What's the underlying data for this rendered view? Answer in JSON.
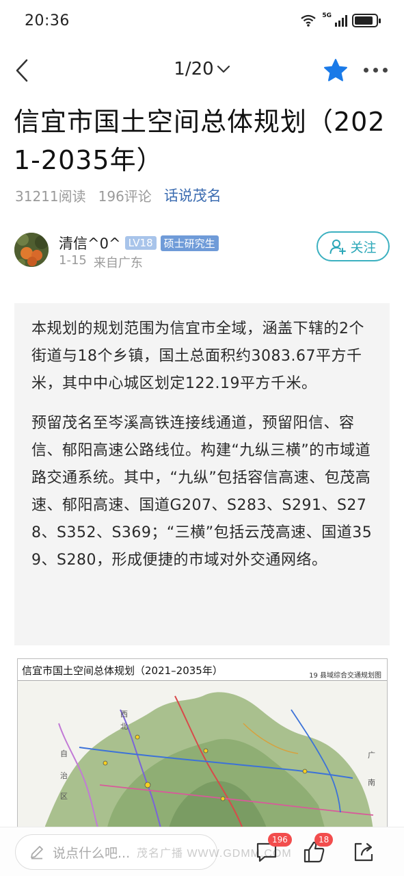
{
  "status_bar": {
    "time": "20:36",
    "network": "5G"
  },
  "nav": {
    "page_indicator": "1/20",
    "star_color": "#1a7ae8"
  },
  "article": {
    "title": "信宜市国土空间总体规划（2021-2035年）",
    "reads": "31211阅读",
    "comments": "196评论",
    "topic": "话说茂名",
    "author": {
      "name": "清信^0^",
      "level": "LV18",
      "degree": "硕士研究生",
      "date": "1-15",
      "location": "来自广东",
      "follow_label": "关注"
    },
    "paragraphs": [
      "本规划的规划范围为信宜市全域，涵盖下辖的2个街道与18个乡镇，国土总面积约3083.67平方千米，其中中心城区划定122.19平方千米。",
      "预留茂名至岑溪高铁连接线通道，预留阳信、容信、郁阳高速公路线位。构建“九纵三横”的市域道路交通系统。其中，“九纵”包括容信高速、包茂高速、郁阳高速、国道G207、S283、S291、S278、S352、S369；“三横”包括云茂高速、国道359、S280，形成便捷的市域对外交通网络。"
    ],
    "map": {
      "title": "信宜市国土空间总体规划（2021–2035年）",
      "subtitle": "19 县域综合交通规划图",
      "labels": [
        "西",
        "北",
        "自",
        "治",
        "区",
        "广",
        "南"
      ]
    }
  },
  "bottom_bar": {
    "comment_placeholder": "说点什么吧...",
    "comment_count": "196",
    "like_count": "18",
    "watermark": "茂名广播 WWW.GDMM.COM"
  }
}
